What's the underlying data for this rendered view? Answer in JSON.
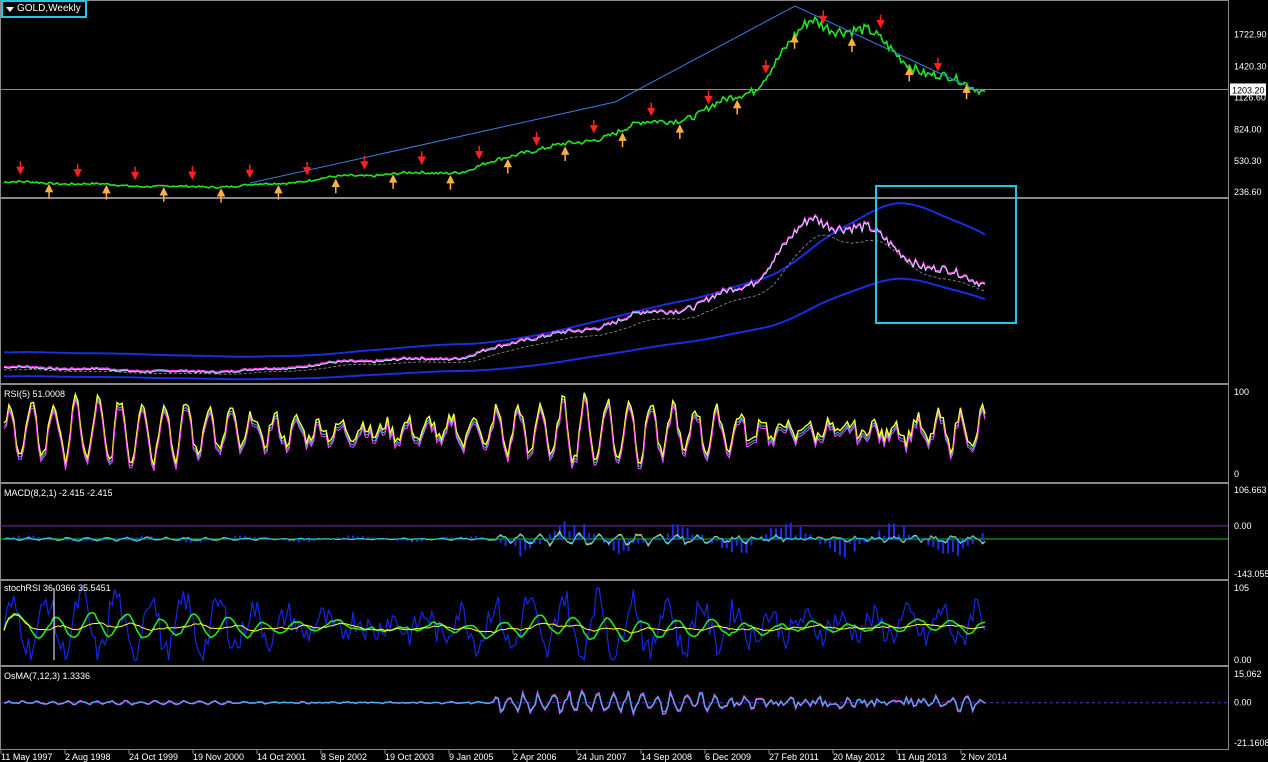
{
  "window": {
    "symbol_title": "GOLD,Weekly"
  },
  "indicators": {
    "rsi_label": "RSI(5) 51.0008",
    "macd_label": "MACD(8,2,1) -2.415 -2.415",
    "stochrsi_label": "stochRSI 36.0366 35.5451",
    "osma_label": "OsMA(7,12,3) 1.3336"
  },
  "colors": {
    "background": "#000000",
    "grid": "#8a8a8a",
    "price_line": "#22e622",
    "trend_line": "#3a7fe6",
    "highlight_box": "#22c8e8",
    "envelope": "#1a2ee0",
    "rsi_yellow": "#ffff33",
    "rsi_magenta": "#ff44ff",
    "stoch_blue": "#1428e8",
    "osma_violet": "#c060ff",
    "arrow_down": "#ff2020",
    "arrow_up": "#ffb040"
  },
  "chart_data": [
    {
      "type": "line",
      "panel": "price",
      "ylim": [
        236.6,
        1990
      ],
      "yticks": [
        "1722.90",
        "1420.30",
        "1126.60",
        "824.00",
        "530.30",
        "236.60"
      ],
      "current_price": "1203.20",
      "xlabels": [
        "11 May 1997",
        "2 Aug 1998",
        "24 Oct 1999",
        "19 Nov 2000",
        "14 Oct 2001",
        "8 Sep 2002",
        "19 Oct 2003",
        "9 Jan 2005",
        "2 Apr 2006",
        "24 Jun 2007",
        "14 Sep 2008",
        "6 Dec 2009",
        "27 Feb 2011",
        "20 May 2012",
        "11 Aug 2013",
        "2 Nov 2014"
      ],
      "series": [
        {
          "x": [
            "1997",
            "1998",
            "1999",
            "2000",
            "2001",
            "2002",
            "2003",
            "2004",
            "2005",
            "2006",
            "2007",
            "2008",
            "2009",
            "2010",
            "2011",
            "2012",
            "2013",
            "2014"
          ],
          "values": [
            330,
            320,
            300,
            285,
            290,
            330,
            390,
            410,
            430,
            620,
            700,
            870,
            960,
            1220,
            1860,
            1720,
            1350,
            1200
          ]
        }
      ]
    },
    {
      "type": "line",
      "panel": "envelope"
    },
    {
      "type": "line",
      "panel": "RSI",
      "ylim": [
        0,
        100
      ],
      "yticks": [
        "100",
        "0"
      ]
    },
    {
      "type": "line",
      "panel": "MACD",
      "ylim": [
        -143.055,
        106.663
      ],
      "yticks": [
        "106.663",
        "0.00",
        "-143.055"
      ]
    },
    {
      "type": "line",
      "panel": "stochRSI",
      "ylim": [
        0,
        105
      ],
      "yticks": [
        "105",
        "0.00"
      ]
    },
    {
      "type": "line",
      "panel": "OsMA",
      "ylim": [
        -21.1608,
        15.062
      ],
      "yticks": [
        "15.062",
        "0.00",
        "-21.1608"
      ]
    }
  ]
}
